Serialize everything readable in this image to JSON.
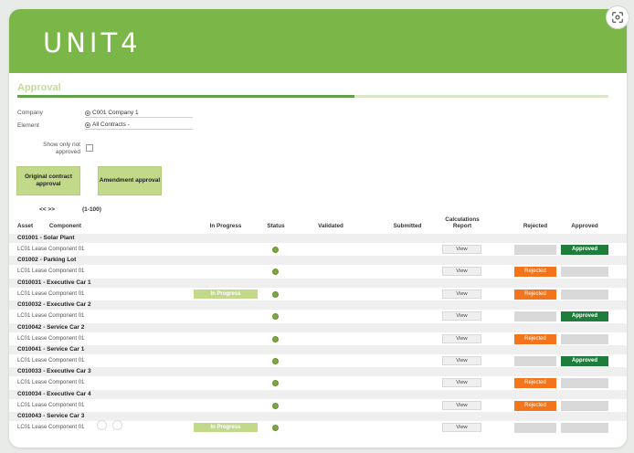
{
  "header": {
    "logo": "UNIT4"
  },
  "page": {
    "title": "Approval",
    "progress_fraction": 0.57
  },
  "filters": {
    "company_label": "Company",
    "company_value": "C001 Company 1",
    "element_label": "Element",
    "element_value": "All Contracts -",
    "show_only_label_line1": "Show only not",
    "show_only_label_line2": "approved"
  },
  "buttons": {
    "original_line1": "Original contract",
    "original_line2": "approval",
    "amendment": "Amendment approval"
  },
  "pager": {
    "arrows": "<< >>",
    "range": "(1-100)"
  },
  "columns": {
    "asset": "Asset",
    "component": "Component",
    "in_progress": "In Progress",
    "status": "Status",
    "validated": "Validated",
    "submitted": "Submitted",
    "calc_line1": "Calculations",
    "calc_line2": "Report",
    "rejected": "Rejected",
    "approved": "Approved"
  },
  "rows": [
    {
      "group": "C01001 - Solar Plant",
      "component": "LC01 Lease Component 01",
      "in_progress": "",
      "view": "View",
      "rejected": "",
      "approved": "Approved"
    },
    {
      "group": "C01002 - Parking Lot",
      "component": "LC01 Lease Component 01",
      "in_progress": "",
      "view": "View",
      "rejected": "Rejected",
      "approved": ""
    },
    {
      "group": "C010031 - Executive Car 1",
      "component": "LC01 Lease Component 01",
      "in_progress": "In Progress",
      "view": "View",
      "rejected": "Rejected",
      "approved": ""
    },
    {
      "group": "C010032 - Executive Car 2",
      "component": "LC01 Lease Component 01",
      "in_progress": "",
      "view": "View",
      "rejected": "",
      "approved": "Approved"
    },
    {
      "group": "C010042 - Service Car 2",
      "component": "LC01 Lease Component 01",
      "in_progress": "",
      "view": "View",
      "rejected": "Rejected",
      "approved": ""
    },
    {
      "group": "C010041 - Service Car 1",
      "component": "LC01 Lease Component 01",
      "in_progress": "",
      "view": "View",
      "rejected": "",
      "approved": "Approved"
    },
    {
      "group": "C010033 - Executive Car 3",
      "component": "LC01 Lease Component 01",
      "in_progress": "",
      "view": "View",
      "rejected": "Rejected",
      "approved": ""
    },
    {
      "group": "C010034 - Executive Car 4",
      "component": "LC01 Lease Component 01",
      "in_progress": "",
      "view": "View",
      "rejected": "Rejected",
      "approved": ""
    },
    {
      "group": "C010043 - Service Car 3",
      "component": "LC01 Lease Component 01",
      "in_progress": "In Progress",
      "view": "View",
      "rejected": "",
      "approved": ""
    }
  ],
  "colors": {
    "brand_green": "#7ab648",
    "approved_green": "#1e7d3a",
    "rejected_orange": "#f4741b",
    "status_dot": "#7ea73f",
    "inprogress_lime": "#c3d98a"
  },
  "icons": {
    "lens": "google-lens-icon",
    "camera": "video-camera-icon",
    "more": "more-options-icon"
  }
}
